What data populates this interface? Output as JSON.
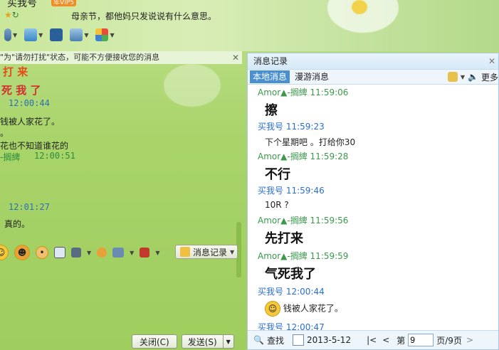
{
  "header": {
    "contact_name": "买我号",
    "vip_label": "年VIP5",
    "signature": "母亲节，都他妈只发说说有什么意思。"
  },
  "left": {
    "notice": "\"为\"请勿打扰\"状态，可能不方便接收您的消息",
    "lines": [
      {
        "text": "打 来",
        "style": "big"
      },
      {
        "text": "死 我 了",
        "style": "big"
      },
      {
        "text": "12:00:44",
        "style": "time-blue"
      },
      {
        "text": "钱被人家花了。",
        "style": "plain"
      },
      {
        "text": "。",
        "style": "plain"
      },
      {
        "text": "花也不知道谁花的",
        "style": "plain"
      },
      {
        "text": "-搁綼",
        "style": "green"
      },
      {
        "text": "12:00:51",
        "style": "time-green"
      },
      {
        "text": "12:01:27",
        "style": "time-blue"
      },
      {
        "text": "真的。",
        "style": "plain"
      }
    ],
    "msg_record_button": "消息记录",
    "close_button": "关闭(C)",
    "send_button": "发送(S)"
  },
  "panel": {
    "title": "消息记录",
    "tabs": [
      "本地消息",
      "漫游消息"
    ],
    "more_label": "更多",
    "messages": [
      {
        "kind": "sender-green",
        "text": "Amor▲-搁綼 11:59:06"
      },
      {
        "kind": "bigtext",
        "text": "擦"
      },
      {
        "kind": "sender-blue",
        "text": "买我号 11:59:23"
      },
      {
        "kind": "text",
        "text": "下个星期吧 。打给你30"
      },
      {
        "kind": "sender-green",
        "text": "Amor▲-搁綼 11:59:28"
      },
      {
        "kind": "bigtext",
        "text": "不行"
      },
      {
        "kind": "sender-blue",
        "text": "买我号 11:59:46"
      },
      {
        "kind": "text",
        "text": "10R  ?"
      },
      {
        "kind": "sender-green",
        "text": "Amor▲-搁綼 11:59:56"
      },
      {
        "kind": "bigtext",
        "text": "先打来"
      },
      {
        "kind": "sender-green",
        "text": "Amor▲-搁綼 11:59:59"
      },
      {
        "kind": "bigtext",
        "text": "气死我了"
      },
      {
        "kind": "sender-blue",
        "text": "买我号 12:00:44"
      },
      {
        "kind": "emoji-text",
        "text": "钱被人家花了。"
      },
      {
        "kind": "sender-blue",
        "text": "买我号 12:00:47"
      }
    ],
    "footer": {
      "search_label": "查找",
      "date": "2013-5-12",
      "page_prefix": "第",
      "page_value": "9",
      "page_suffix": "页/9页"
    }
  },
  "colors": {
    "accent": "#4a90d0",
    "green_sender": "#3a9a4a",
    "blue_sender": "#2a6fd0"
  }
}
